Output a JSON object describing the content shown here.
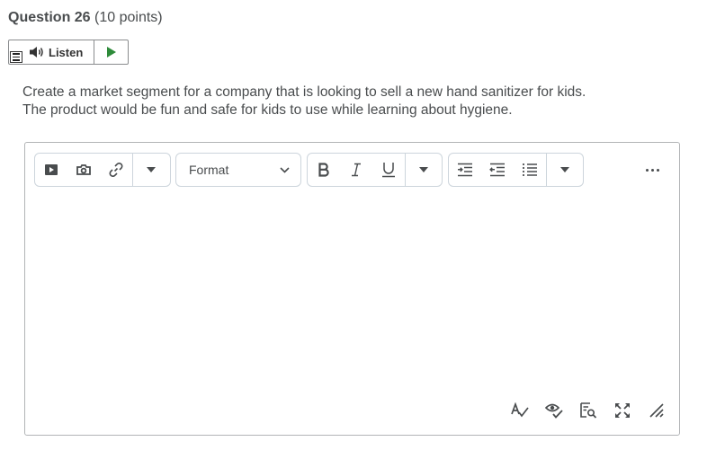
{
  "question": {
    "title": "Question 26",
    "points": "(10 points)",
    "text_line1": "Create a market segment for a company that is looking to sell a new hand sanitizer for kids.",
    "text_line2": "The product would be fun and safe for kids to use while learning about hygiene."
  },
  "listen": {
    "label": "Listen",
    "icons": [
      "menu-icon",
      "speaker-icon",
      "play-icon"
    ],
    "play_color": "#2e8b3a"
  },
  "editor": {
    "format_label": "Format",
    "toolbar_icons": [
      "insert-video-icon",
      "insert-image-icon",
      "insert-link-icon",
      "dropdown-icon",
      "bold-icon",
      "italic-icon",
      "underline-icon",
      "dropdown-icon",
      "indent-icon",
      "outdent-icon",
      "list-icon",
      "dropdown-icon",
      "more-options-icon"
    ],
    "bottom_icons": [
      "spellcheck-icon",
      "accessibility-checker-icon",
      "preview-icon",
      "fullscreen-icon",
      "resize-handle-icon"
    ],
    "content": ""
  }
}
